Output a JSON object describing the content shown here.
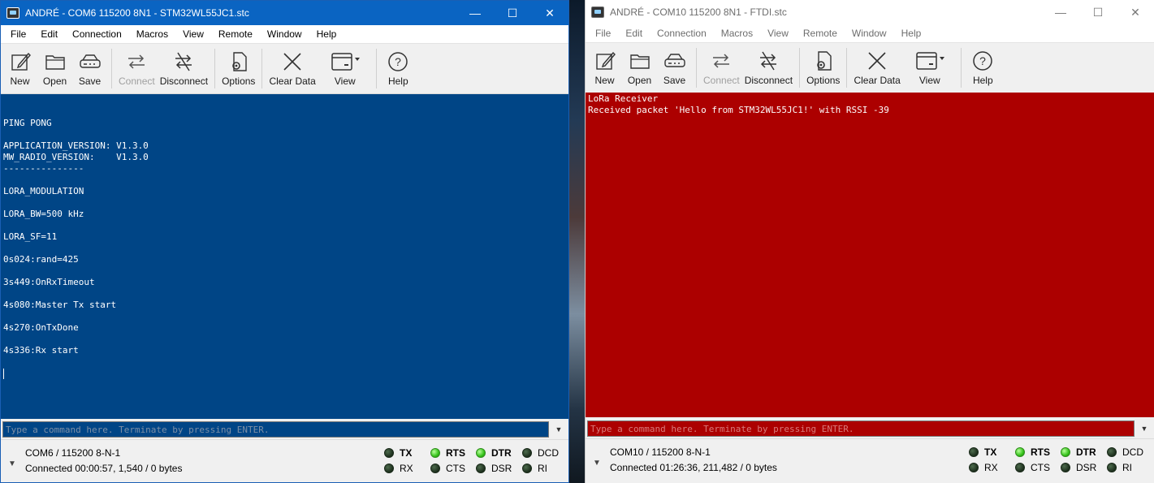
{
  "windows": {
    "left": {
      "title": "ANDRÉ - COM6 115200 8N1 - STM32WL55JC1.stc",
      "menu": [
        "File",
        "Edit",
        "Connection",
        "Macros",
        "View",
        "Remote",
        "Window",
        "Help"
      ],
      "toolbar": {
        "new": "New",
        "open": "Open",
        "save": "Save",
        "connect": "Connect",
        "disconnect": "Disconnect",
        "options": "Options",
        "clear": "Clear Data",
        "view": "View",
        "help": "Help"
      },
      "terminal_lines": [
        "",
        "",
        "PING PONG",
        "",
        "APPLICATION_VERSION: V1.3.0",
        "MW_RADIO_VERSION:    V1.3.0",
        "---------------",
        "",
        "LORA_MODULATION",
        "",
        "LORA_BW=500 kHz",
        "",
        "LORA_SF=11",
        "",
        "0s024:rand=425",
        "",
        "3s449:OnRxTimeout",
        "",
        "4s080:Master Tx start",
        "",
        "4s270:OnTxDone",
        "",
        "4s336:Rx start",
        ""
      ],
      "command_placeholder": "Type a command here. Terminate by pressing ENTER.",
      "status": {
        "port": "COM6 / 115200 8-N-1",
        "connection": "Connected 00:00:57, 1,540 / 0 bytes"
      },
      "signals": {
        "tx": {
          "label": "TX",
          "on": false
        },
        "rts": {
          "label": "RTS",
          "on": true
        },
        "dtr": {
          "label": "DTR",
          "on": true
        },
        "dcd": {
          "label": "DCD",
          "on": false
        },
        "rx": {
          "label": "RX",
          "on": false
        },
        "cts": {
          "label": "CTS",
          "on": false
        },
        "dsr": {
          "label": "DSR",
          "on": false
        },
        "ri": {
          "label": "RI",
          "on": false
        }
      },
      "colors": {
        "terminal_bg": "#004586",
        "titlebar": "#0a64c2"
      }
    },
    "right": {
      "title": "ANDRÉ - COM10 115200 8N1 - FTDI.stc",
      "menu": [
        "File",
        "Edit",
        "Connection",
        "Macros",
        "View",
        "Remote",
        "Window",
        "Help"
      ],
      "toolbar": {
        "new": "New",
        "open": "Open",
        "save": "Save",
        "connect": "Connect",
        "disconnect": "Disconnect",
        "options": "Options",
        "clear": "Clear Data",
        "view": "View",
        "help": "Help"
      },
      "terminal_lines": [
        "LoRa Receiver",
        "Received packet 'Hello from STM32WL55JC1!' with RSSI -39"
      ],
      "command_placeholder": "Type a command here. Terminate by pressing ENTER.",
      "status": {
        "port": "COM10 / 115200 8-N-1",
        "connection": "Connected 01:26:36, 211,482 / 0 bytes"
      },
      "signals": {
        "tx": {
          "label": "TX",
          "on": false
        },
        "rts": {
          "label": "RTS",
          "on": true
        },
        "dtr": {
          "label": "DTR",
          "on": true
        },
        "dcd": {
          "label": "DCD",
          "on": false
        },
        "rx": {
          "label": "RX",
          "on": false
        },
        "cts": {
          "label": "CTS",
          "on": false
        },
        "dsr": {
          "label": "DSR",
          "on": false
        },
        "ri": {
          "label": "RI",
          "on": false
        }
      },
      "colors": {
        "terminal_bg": "#ac0000",
        "titlebar": "#ffffff"
      }
    }
  }
}
